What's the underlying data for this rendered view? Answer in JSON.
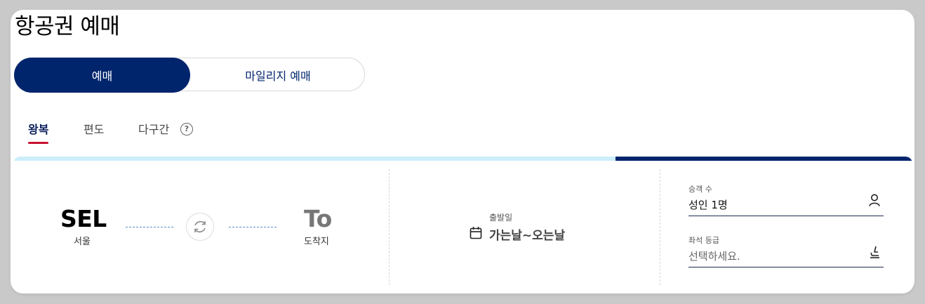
{
  "page": {
    "title": "항공권 예매"
  },
  "mode_toggle": {
    "options": [
      {
        "label": "예매",
        "active": true
      },
      {
        "label": "마일리지 예매",
        "active": false
      }
    ]
  },
  "trip_tabs": {
    "items": [
      {
        "label": "왕복",
        "active": true
      },
      {
        "label": "편도",
        "active": false
      },
      {
        "label": "다구간",
        "active": false
      }
    ],
    "help_icon": "question-circle-icon",
    "help_glyph": "?"
  },
  "route": {
    "origin": {
      "code": "SEL",
      "name": "서울"
    },
    "destination": {
      "code": "To",
      "name": "도착지"
    },
    "swap_icon": "swap-arrows-icon"
  },
  "dates": {
    "label": "출발일",
    "value": "가는날~오는날",
    "icon": "calendar-icon"
  },
  "passengers": {
    "label": "승객 수",
    "value": "성인 1명",
    "icon": "person-icon"
  },
  "seat_class": {
    "label": "좌석 등급",
    "placeholder": "선택하세요.",
    "icon": "seat-icon"
  },
  "progress": {
    "fraction": 0.33
  },
  "colors": {
    "primary": "#00256c",
    "accent_underline": "#c8102e",
    "progress_track": "#cdeefb",
    "muted_code": "#777777",
    "text": "#222222"
  }
}
